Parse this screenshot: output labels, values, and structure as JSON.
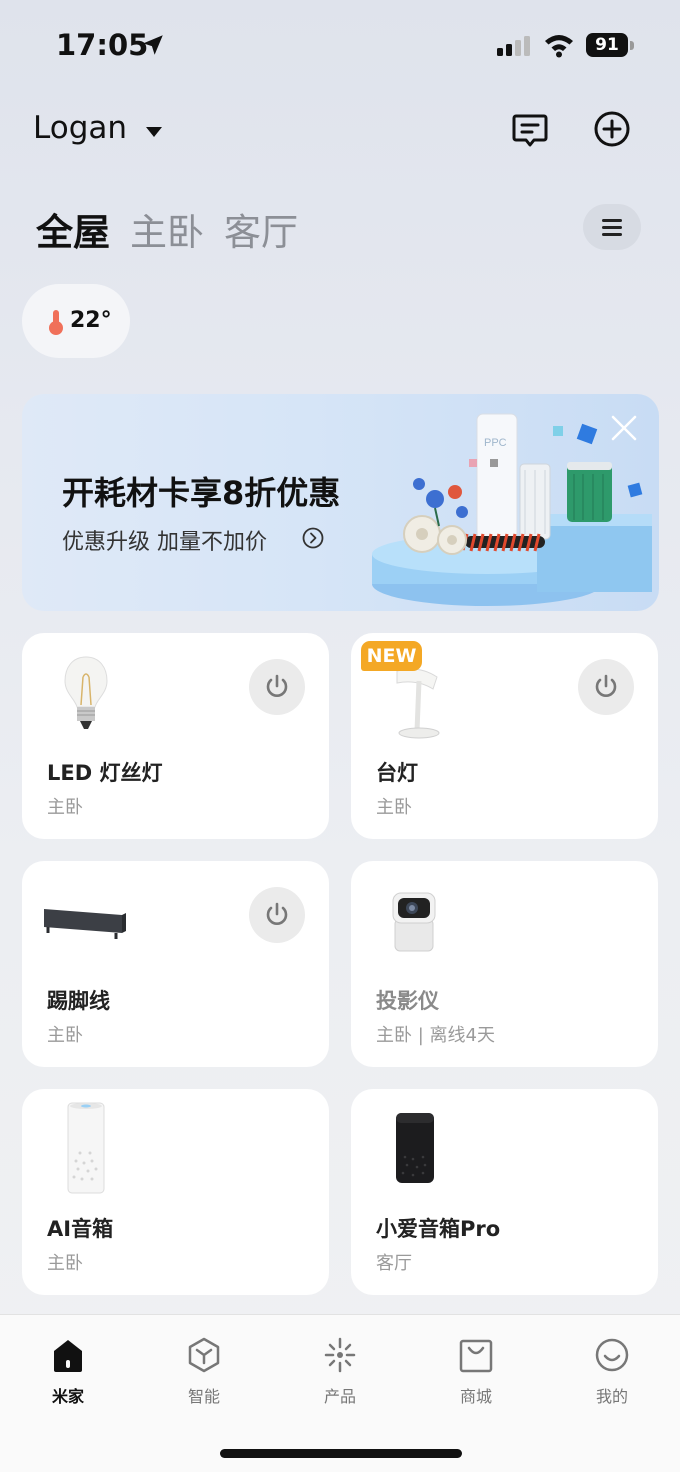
{
  "status_bar": {
    "time": "17:05",
    "battery": "91"
  },
  "header": {
    "home_name": "Logan",
    "message_icon": "message-icon",
    "add_icon": "add-icon"
  },
  "rooms": {
    "tabs": [
      "全屋",
      "主卧",
      "客厅"
    ],
    "active_index": 0
  },
  "temperature": {
    "value": "22°"
  },
  "banner": {
    "title": "开耗材卡享8折优惠",
    "subtitle": "优惠升级 加量不加价",
    "art_text": "PPC"
  },
  "devices": [
    {
      "name": "LED 灯丝灯",
      "room": "主卧",
      "power_button": true,
      "is_new": false,
      "offline": false,
      "icon": "filament-bulb-icon"
    },
    {
      "name": "台灯",
      "room": "主卧",
      "power_button": true,
      "is_new": true,
      "new_label": "NEW",
      "offline": false,
      "icon": "desk-lamp-icon"
    },
    {
      "name": "踢脚线",
      "room": "主卧",
      "power_button": true,
      "is_new": false,
      "offline": false,
      "icon": "baseboard-heater-icon"
    },
    {
      "name": "投影仪",
      "room": "主卧 | 离线4天",
      "power_button": false,
      "is_new": false,
      "offline": true,
      "icon": "projector-icon"
    },
    {
      "name": "AI音箱",
      "room": "主卧",
      "power_button": false,
      "is_new": false,
      "offline": false,
      "icon": "white-speaker-icon"
    },
    {
      "name": "小爱音箱Pro",
      "room": "客厅",
      "power_button": false,
      "is_new": false,
      "offline": false,
      "icon": "black-speaker-icon"
    }
  ],
  "bottom_nav": {
    "items": [
      {
        "label": "米家",
        "icon": "home-icon",
        "active": true
      },
      {
        "label": "智能",
        "icon": "smart-hexagon-icon",
        "active": false
      },
      {
        "label": "产品",
        "icon": "product-sparkle-icon",
        "active": false
      },
      {
        "label": "商城",
        "icon": "shopping-bag-icon",
        "active": false
      },
      {
        "label": "我的",
        "icon": "smiley-profile-icon",
        "active": false
      }
    ]
  },
  "colors": {
    "accent_new": "#f4a825",
    "thermo": "#f0705a",
    "background": "#e6e9f0"
  }
}
